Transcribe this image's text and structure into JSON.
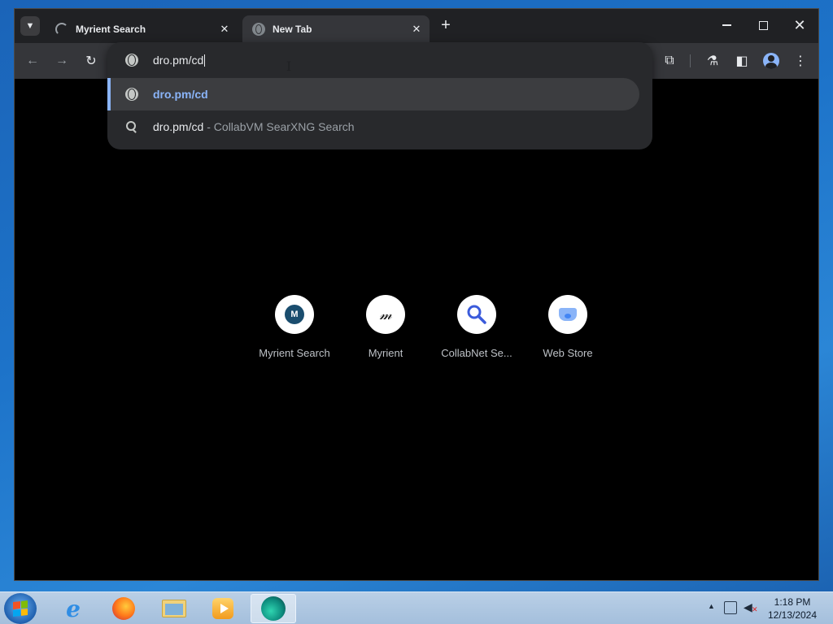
{
  "tabs": [
    {
      "title": "Myrient Search",
      "icon": "loading-spinner-icon",
      "close": "✕"
    },
    {
      "title": "New Tab",
      "icon": "globe-icon",
      "close": "✕",
      "active": true
    }
  ],
  "toolbar": {
    "new_tab": "+",
    "tab_search": "⌄"
  },
  "omnibox": {
    "value": "dro.pm/cd",
    "suggestions": [
      {
        "icon": "globe-icon",
        "text": "dro.pm/cd",
        "desc": ""
      },
      {
        "icon": "search-icon",
        "text": "dro.pm/cd",
        "desc": "- CollabVM SearXNG Search"
      }
    ]
  },
  "shortcuts": [
    {
      "label": "Myrient Search",
      "icon": "myrient-search-icon",
      "glyph": "M"
    },
    {
      "label": "Myrient",
      "icon": "myrient-icon",
      "glyph": "𝓂"
    },
    {
      "label": "CollabNet Se...",
      "icon": "collabnet-search-icon",
      "glyph": ""
    },
    {
      "label": "Web Store",
      "icon": "web-store-icon",
      "glyph": ""
    }
  ],
  "taskbar": {
    "clock_time": "1:18 PM",
    "clock_date": "12/13/2024",
    "apps": [
      "internet-explorer-icon",
      "firefox-icon",
      "file-explorer-icon",
      "media-player-icon",
      "browser-icon"
    ]
  },
  "colors": {
    "accent": "#8ab4f8",
    "toolbar_bg": "#35363a",
    "titlebar_bg": "#202124",
    "omnibox_bg": "#28292c",
    "page_bg": "#000000"
  }
}
